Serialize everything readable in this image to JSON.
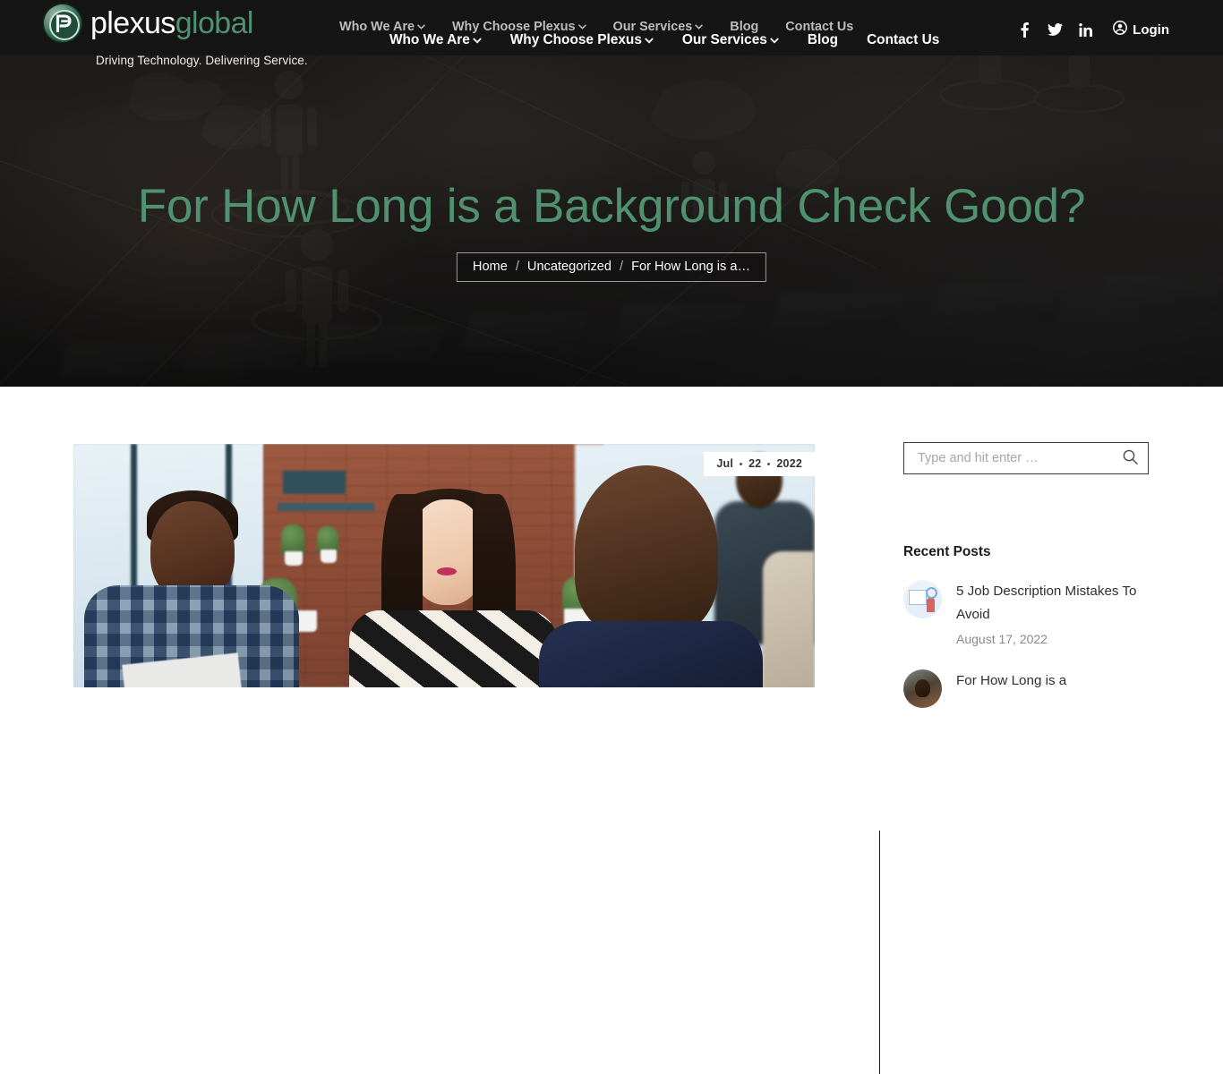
{
  "header": {
    "logo": {
      "word_primary": "plexus",
      "word_accent": "global",
      "tagline": "Driving Technology. Delivering Service.",
      "mark_letter": "P"
    },
    "nav_items": [
      {
        "label": "Who We Are",
        "has_caret": true
      },
      {
        "label": "Why Choose Plexus",
        "has_caret": true
      },
      {
        "label": "Our Services",
        "has_caret": true
      },
      {
        "label": "Blog",
        "has_caret": false
      },
      {
        "label": "Contact Us",
        "has_caret": false
      }
    ],
    "social": [
      {
        "name": "facebook",
        "glyph": "f"
      },
      {
        "name": "twitter",
        "glyph": "t"
      },
      {
        "name": "linkedin",
        "glyph": "in"
      }
    ],
    "login_label": "Login",
    "background_color": "#151515",
    "accent_color": "#4e9173"
  },
  "hero": {
    "title": "For How Long is a Background Check Good?",
    "title_color": "#50926f",
    "breadcrumb": [
      {
        "label": "Home",
        "is_link": true
      },
      {
        "label": "Uncategorized",
        "is_link": true
      },
      {
        "label": "For How Long is a…",
        "is_link": false
      }
    ],
    "breadcrumb_separator": "/"
  },
  "post": {
    "date": {
      "month": "Jul",
      "day": "22",
      "year": "2022"
    },
    "image_alt": "Three colleagues in an office interview meeting"
  },
  "sidebar": {
    "search": {
      "placeholder": "Type and hit enter …",
      "value": "",
      "icon": "search-icon"
    },
    "recent_posts_title": "Recent Posts",
    "recent_posts": [
      {
        "title": "5 Job Description Mistakes To Avoid",
        "date": "August 17, 2022"
      },
      {
        "title": "For How Long is a",
        "date": ""
      }
    ]
  }
}
